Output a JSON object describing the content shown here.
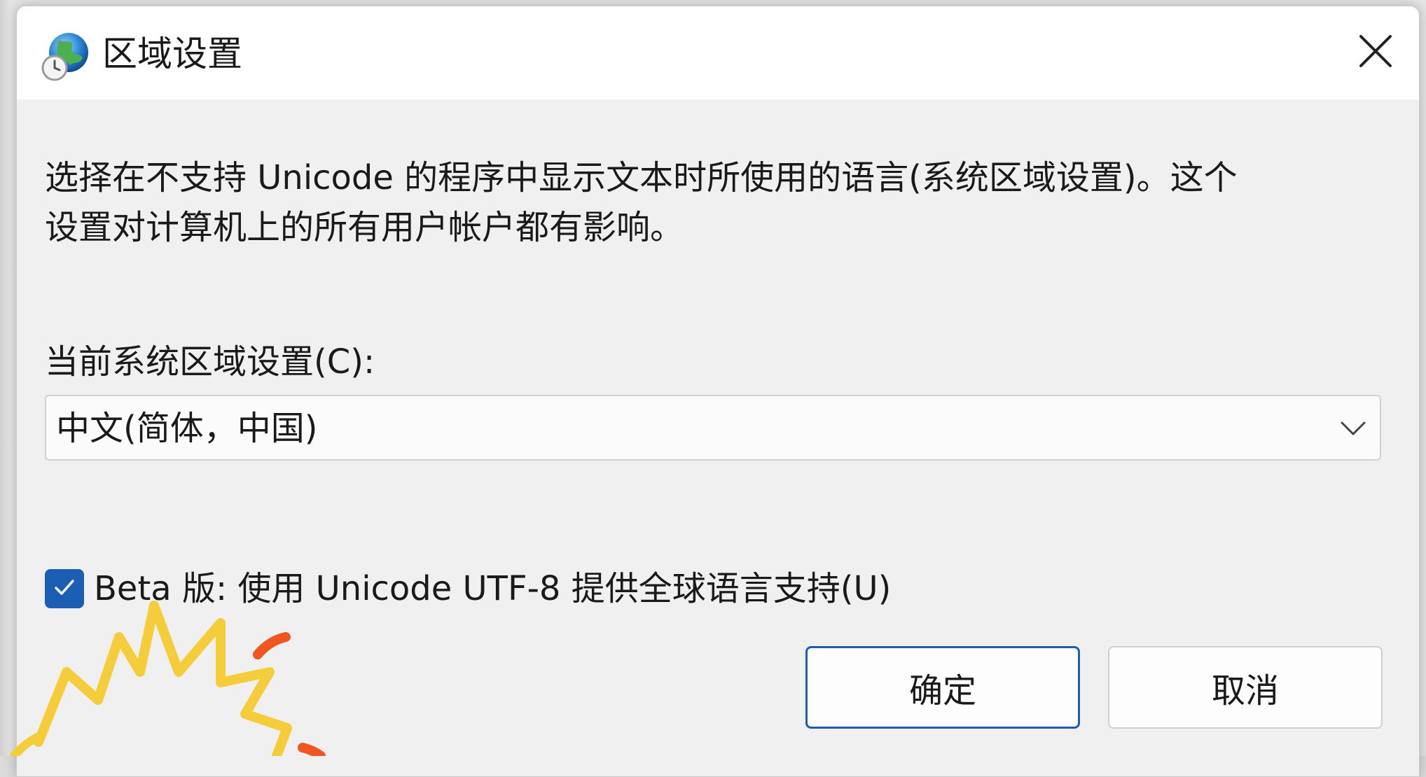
{
  "window": {
    "title": "区域设置",
    "close_icon": "close-icon"
  },
  "description": {
    "line1": "选择在不支持 Unicode 的程序中显示文本时所使用的语言(系统区域设置)。这个",
    "line2": "设置对计算机上的所有用户帐户都有影响。"
  },
  "locale": {
    "label": "当前系统区域设置(C):",
    "selected": "中文(简体，中国)"
  },
  "beta": {
    "label": "Beta 版: 使用 Unicode UTF-8 提供全球语言支持(U)",
    "checked": true
  },
  "buttons": {
    "ok": "确定",
    "cancel": "取消"
  },
  "colors": {
    "accent": "#1b5fb5",
    "doodle_yellow": "#f5cc3a",
    "doodle_orange": "#f0561d"
  }
}
